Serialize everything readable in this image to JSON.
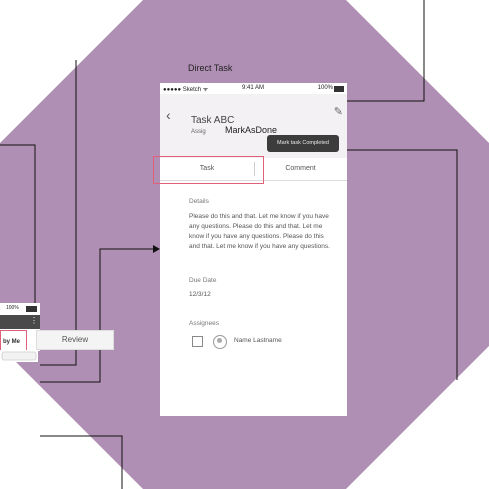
{
  "caption": "Direct Task",
  "colors": {
    "background": "#b08fb4",
    "phone": "#ffffff",
    "highlight": "#e0607a",
    "diamond": "#fbe03a",
    "toast": "#3c3c3c"
  },
  "phone": {
    "status": {
      "carrier": "●●●●● Sketch ᯤ",
      "time": "9:41 AM",
      "battery": "100%"
    },
    "header": {
      "back_icon": "‹",
      "edit_icon": "✎",
      "title": "Task ABC",
      "assigned_prefix": "Assig"
    },
    "toast": "Mark task Completed",
    "tabs": {
      "task": "Task",
      "comment": "Comment"
    },
    "details": {
      "label": "Details",
      "text": "Please do this and that. Let me know if you have any questions. Please do this and that. Let me know if you have any questions. Please do this and that. Let me know if you have any questions."
    },
    "due": {
      "label": "Due Date",
      "value": "12/3/12"
    },
    "assignees": {
      "label": "Assignees",
      "name": "Name Lastname"
    }
  },
  "diamond": {
    "label": "MarkAsDone"
  },
  "mini_phone": {
    "battery": "100%",
    "dots": "⋮",
    "tab_label": "by Me"
  },
  "review": {
    "label": "Review"
  }
}
